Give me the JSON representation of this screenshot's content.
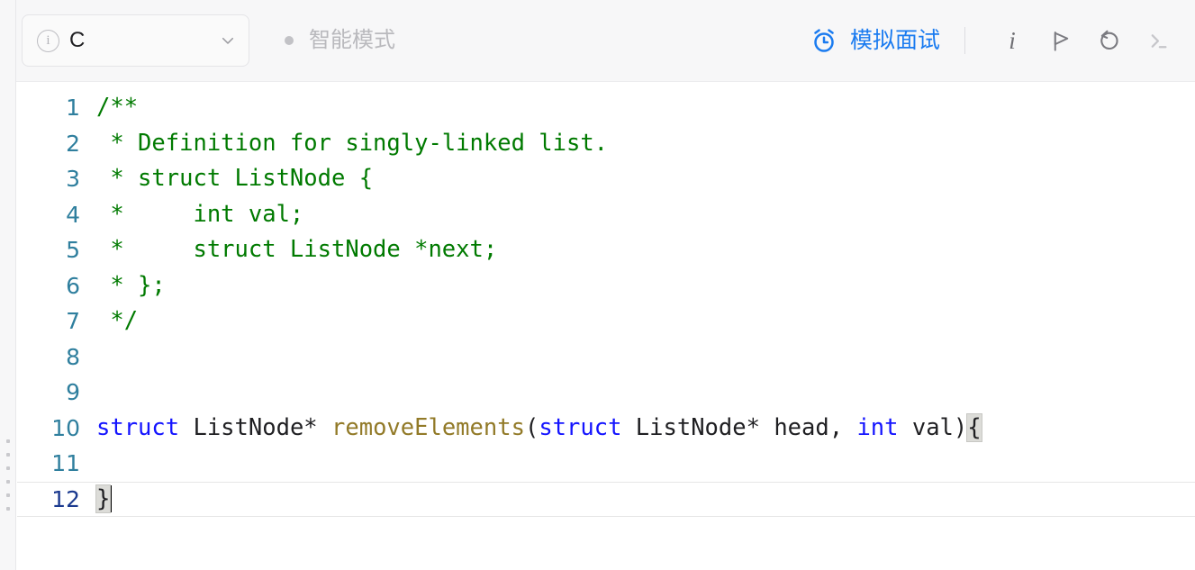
{
  "toolbar": {
    "language_select": {
      "info_icon": "info-circle-icon",
      "value": "C",
      "chevron_icon": "chevron-down-icon"
    },
    "smart_mode": {
      "dot_icon": "status-dot-icon",
      "label": "智能模式"
    },
    "mock_interview": {
      "icon": "alarm-clock-icon",
      "label": "模拟面试",
      "color": "#1a7bf0"
    },
    "actions": [
      {
        "name": "info-button",
        "glyph": "i",
        "icon": "info-italic-icon"
      },
      {
        "name": "flag-button",
        "icon": "flag-icon"
      },
      {
        "name": "reset-button",
        "icon": "undo-arrow-icon"
      },
      {
        "name": "console-button",
        "icon": "terminal-icon"
      }
    ]
  },
  "editor": {
    "language": "C",
    "cursor_line": 12,
    "lines": [
      {
        "number": "1",
        "tokens": [
          {
            "t": "/**",
            "c": "cm"
          }
        ]
      },
      {
        "number": "2",
        "tokens": [
          {
            "t": " * Definition for singly-linked list.",
            "c": "cm"
          }
        ]
      },
      {
        "number": "3",
        "tokens": [
          {
            "t": " * struct ListNode {",
            "c": "cm"
          }
        ]
      },
      {
        "number": "4",
        "tokens": [
          {
            "t": " *     int val;",
            "c": "cm"
          }
        ]
      },
      {
        "number": "5",
        "tokens": [
          {
            "t": " *     struct ListNode *next;",
            "c": "cm"
          }
        ]
      },
      {
        "number": "6",
        "tokens": [
          {
            "t": " * };",
            "c": "cm"
          }
        ]
      },
      {
        "number": "7",
        "tokens": [
          {
            "t": " */",
            "c": "cm"
          }
        ]
      },
      {
        "number": "8",
        "tokens": []
      },
      {
        "number": "9",
        "tokens": []
      },
      {
        "number": "10",
        "tokens": [
          {
            "t": "struct",
            "c": "kw"
          },
          {
            "t": " ListNode* ",
            "c": "pl"
          },
          {
            "t": "removeElements",
            "c": "fn"
          },
          {
            "t": "(",
            "c": "pl"
          },
          {
            "t": "struct",
            "c": "kw"
          },
          {
            "t": " ListNode* head, ",
            "c": "pl"
          },
          {
            "t": "int",
            "c": "kw"
          },
          {
            "t": " val)",
            "c": "pl"
          },
          {
            "t": "{",
            "c": "brk"
          }
        ]
      },
      {
        "number": "11",
        "tokens": []
      },
      {
        "number": "12",
        "active": true,
        "caret": true,
        "tokens": [
          {
            "t": "}",
            "c": "brk"
          }
        ]
      }
    ]
  },
  "left_rail": {
    "grip_icon": "drag-grip-icon",
    "dots": 6
  }
}
